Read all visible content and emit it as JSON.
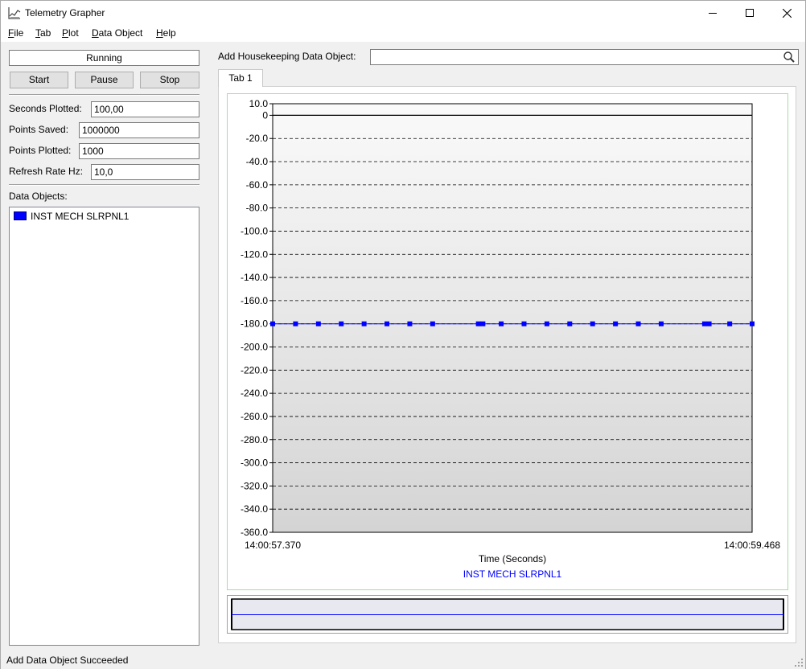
{
  "window": {
    "title": "Telemetry Grapher",
    "icon": "chart-app-icon",
    "controls": [
      "minimize-icon",
      "maximize-icon",
      "close-icon"
    ]
  },
  "menu": [
    {
      "mnemonic": "F",
      "rest": "ile"
    },
    {
      "mnemonic": "T",
      "rest": "ab"
    },
    {
      "mnemonic": "P",
      "rest": "lot"
    },
    {
      "mnemonic": "D",
      "rest": "ata Object"
    },
    {
      "mnemonic": "H",
      "rest": "elp"
    }
  ],
  "control": {
    "status": "Running",
    "start_label": "Start",
    "pause_label": "Pause",
    "stop_label": "Stop"
  },
  "settings": {
    "seconds_plotted_label": "Seconds Plotted:",
    "seconds_plotted_value": "100,00",
    "points_saved_label": "Points Saved:",
    "points_saved_value": "1000000",
    "points_plotted_label": "Points Plotted:",
    "points_plotted_value": "1000",
    "refresh_rate_label": "Refresh Rate Hz:",
    "refresh_rate_value": "10,0"
  },
  "data_objects": {
    "label": "Data Objects:",
    "items": [
      {
        "name": "INST MECH SLRPNL1",
        "color": "#0000ff"
      }
    ]
  },
  "add_object": {
    "label": "Add Housekeeping Data Object:",
    "value": "",
    "icon": "search-icon"
  },
  "tabs": [
    {
      "label": "Tab 1"
    }
  ],
  "chart_data": {
    "type": "line",
    "xlabel": "Time (Seconds)",
    "ylabel": "",
    "x_tick_labels": [
      "14:00:57.370",
      "14:00:59.468"
    ],
    "y_tick_labels": [
      "10.0",
      "0",
      "-20.0",
      "-40.0",
      "-60.0",
      "-80.0",
      "-100.0",
      "-120.0",
      "-140.0",
      "-160.0",
      "-180.0",
      "-200.0",
      "-220.0",
      "-240.0",
      "-260.0",
      "-280.0",
      "-300.0",
      "-320.0",
      "-340.0",
      "-360.0"
    ],
    "ylim": [
      -360,
      10
    ],
    "grid": true,
    "legend": "bottom-center",
    "series": [
      {
        "name": "INST MECH SLRPNL1",
        "color": "#0000ff",
        "marker": "square",
        "x": [
          0.0,
          0.1,
          0.2,
          0.3,
          0.4,
          0.5,
          0.6,
          0.7,
          0.9,
          0.92,
          1.0,
          1.1,
          1.2,
          1.3,
          1.4,
          1.5,
          1.6,
          1.7,
          1.89,
          1.91,
          2.0,
          2.098
        ],
        "values": [
          -180,
          -180,
          -180,
          -180,
          -180,
          -180,
          -180,
          -180,
          -180,
          -180,
          -180,
          -180,
          -180,
          -180,
          -180,
          -180,
          -180,
          -180,
          -180,
          -180,
          -180,
          -180
        ]
      }
    ]
  },
  "status_bar": {
    "message": "Add Data Object Succeeded"
  }
}
